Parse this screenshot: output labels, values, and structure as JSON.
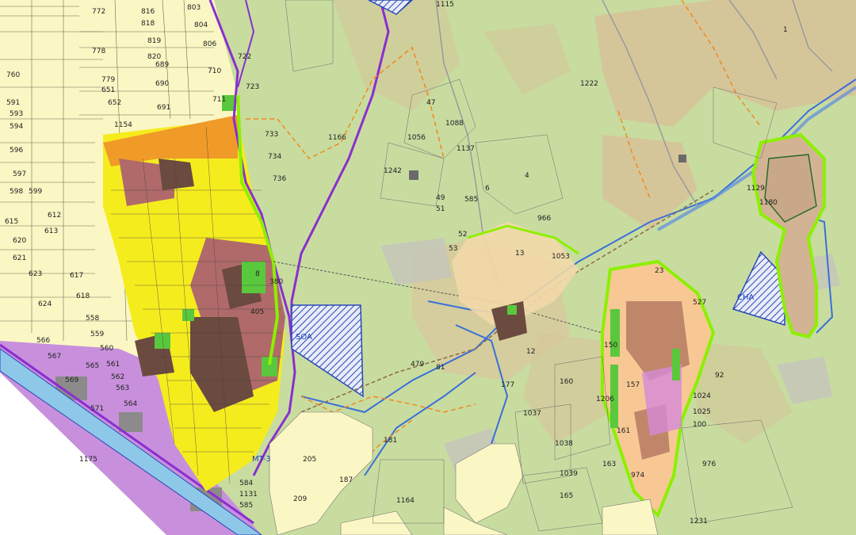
{
  "map": {
    "colors": {
      "background": "#c8dca0",
      "farmland": "#fbf7c4",
      "residential": "#f5ec1e",
      "mixed": "#a86a5c",
      "dense": "#6b4a40",
      "commercial": "#f09a28",
      "park": "#5ac83c",
      "industrial": "#b878d0",
      "settlement": "#f7d0a0",
      "forest_clearing": "#d8c49a",
      "sea": "#8ec8e8",
      "hatch": "#2a47b8",
      "river": "#3a6fd8",
      "road": "#9a9a9a",
      "boundary": "#8a2ed0",
      "trail": "#f08a1e",
      "greenbelt": "#8cf000"
    },
    "zone_labels": {
      "soa": "SOA",
      "cha": "CHA",
      "mt3": "MT-3"
    },
    "parcel_labels": [
      "803",
      "816",
      "818",
      "804",
      "819",
      "806",
      "820",
      "772",
      "778",
      "760",
      "689",
      "710",
      "690",
      "779",
      "651",
      "591",
      "652",
      "691",
      "711",
      "1154",
      "593",
      "594",
      "596",
      "597",
      "598",
      "599",
      "612",
      "613",
      "615",
      "620",
      "621",
      "623",
      "624",
      "617",
      "618",
      "558",
      "559",
      "566",
      "567",
      "560",
      "561",
      "562",
      "563",
      "565",
      "569",
      "571",
      "564",
      "1175",
      "1166",
      "723",
      "733",
      "734",
      "736",
      "47",
      "1088",
      "1056",
      "1137",
      "1242",
      "49",
      "51",
      "6",
      "4",
      "966",
      "13",
      "12",
      "1222",
      "1",
      "1180",
      "1129",
      "160",
      "1037",
      "1038",
      "1039",
      "976",
      "181",
      "205",
      "187",
      "209",
      "1164",
      "1231",
      "974",
      "163",
      "165",
      "177",
      "81",
      "479",
      "8",
      "380",
      "405",
      "527",
      "150",
      "1024",
      "1025",
      "100",
      "92",
      "161",
      "585",
      "1131",
      "722",
      "1115",
      "1053",
      "23",
      "52",
      "53",
      "585",
      "1206",
      "157",
      "584"
    ]
  }
}
